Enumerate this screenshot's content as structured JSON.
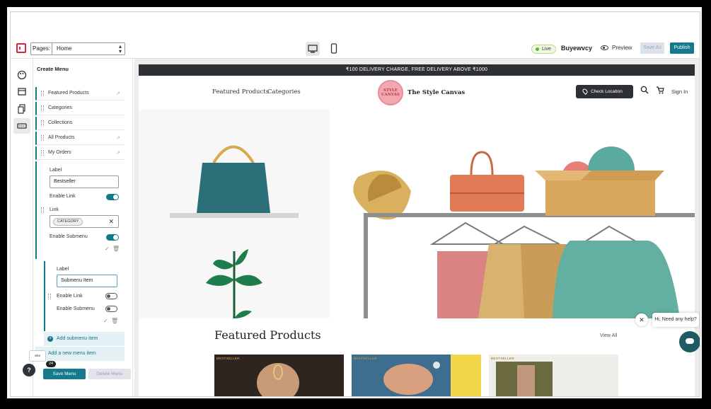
{
  "topbar": {
    "pages_label": "Pages:",
    "pages_value": "Home",
    "live_label": "Live",
    "store_name": "Buyewvcy",
    "preview_label": "Preview",
    "save_as_label": "Save As",
    "publish_label": "Publish"
  },
  "panel": {
    "title": "Create Menu",
    "items": [
      {
        "label": "Featured Products"
      },
      {
        "label": "Categories"
      },
      {
        "label": "Collections"
      },
      {
        "label": "All Products"
      },
      {
        "label": "My Orders"
      }
    ],
    "expanded": {
      "label_caption": "Label",
      "label_value": "Bestseller",
      "enable_link_label": "Enable Link",
      "link_caption": "Link",
      "link_chip": "CATEGORY",
      "enable_submenu_label": "Enable Submenu"
    },
    "submenu": {
      "label_caption": "Label",
      "label_value": "Submenu Item",
      "enable_link_label": "Enable Link",
      "enable_submenu_label": "Enable Submenu"
    },
    "add_submenu_label": "Add submenu item",
    "add_new_label": "Add a new menu item",
    "save_menu_label": "Save Menu",
    "delete_menu_label": "Delete Menu",
    "badge_count": "24"
  },
  "store": {
    "announcement": "₹100 DELIVERY CHARGE, FREE DELIVERY ABOVE ₹1000",
    "nav": [
      "Featured Products",
      "Categories"
    ],
    "brand_logo_text": "STYLE CANVAS",
    "brand_name": "The Style Canvas",
    "check_location_label": "Check Location",
    "sign_in_label": "Sign In",
    "featured_title": "Featured Products",
    "view_all_label": "View All",
    "product_tags": [
      "BESTSELLER",
      "BESTSELLER",
      "BESTSELLER"
    ]
  },
  "chat": {
    "greeting": "Hi, Need any help?"
  },
  "colors": {
    "accent": "#157a8c",
    "dark": "#2d3035",
    "live_green": "#5cb82e",
    "chat": "#1f5b63"
  }
}
